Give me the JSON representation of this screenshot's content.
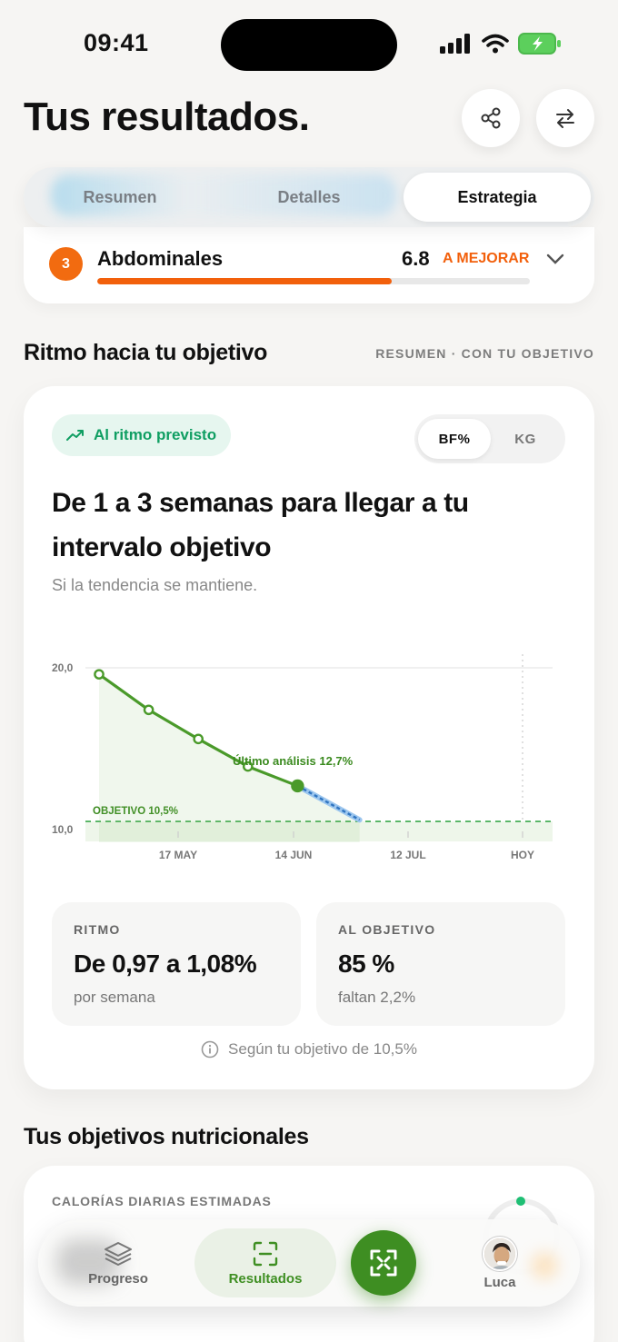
{
  "status": {
    "time": "09:41"
  },
  "header": {
    "title": "Tus resultados."
  },
  "tabs": [
    {
      "label": "Resumen",
      "active": false
    },
    {
      "label": "Detalles",
      "active": false
    },
    {
      "label": "Estrategia",
      "active": true
    }
  ],
  "abdominales": {
    "rank": "3",
    "label": "Abdominales",
    "score": "6.8",
    "status": "A MEJORAR",
    "progress": 0.68
  },
  "pace": {
    "section_title": "Ritmo hacia tu objetivo",
    "section_subtitle": "RESUMEN · CON TU OBJETIVO",
    "status_pill": "Al ritmo previsto",
    "unit_options": [
      "BF%",
      "KG"
    ],
    "selected_unit": "BF%",
    "headline": "De 1 a 3 semanas para llegar a tu intervalo objetivo",
    "subline": "Si la tendencia se mantiene.",
    "stats": {
      "ritmo_label": "RITMO",
      "ritmo_value": "De 0,97 a 1,08%",
      "ritmo_sub": "por semana",
      "objetivo_label": "AL OBJETIVO",
      "objetivo_value": "85 %",
      "objetivo_sub": "faltan 2,2%"
    },
    "note": "Según tu objetivo de 10,5%"
  },
  "chart_data": {
    "type": "line",
    "y_ticks": [
      "20,0",
      "10,0"
    ],
    "ylim": [
      10,
      20
    ],
    "x_ticks": [
      "17 MAY",
      "14 JUN",
      "12 JUL",
      "HOY"
    ],
    "series": [
      {
        "points": [
          {
            "day": 0,
            "value": 19.6
          },
          {
            "day": 12,
            "value": 17.4
          },
          {
            "day": 24,
            "value": 15.6
          },
          {
            "day": 36,
            "value": 13.9
          },
          {
            "day": 48,
            "value": 12.7
          }
        ]
      },
      {
        "projection": true,
        "points": [
          {
            "day": 48,
            "value": 12.7
          },
          {
            "day": 63,
            "value": 10.6
          }
        ]
      }
    ],
    "target_value": 10.5,
    "target_label": "OBJETIVO 10,5%",
    "last_label": "Último análisis 12,7%",
    "colors": {
      "line": "#4a9a2a",
      "projection": "#2f74c0",
      "target": "#3aa84a"
    }
  },
  "nutrition": {
    "section_title": "Tus objetivos nutricionales",
    "calories_label": "CALORÍAS DIARIAS ESTIMADAS"
  },
  "tabbar": {
    "items": [
      "Progreso",
      "Resultados",
      "Luca"
    ],
    "active": "Resultados"
  }
}
